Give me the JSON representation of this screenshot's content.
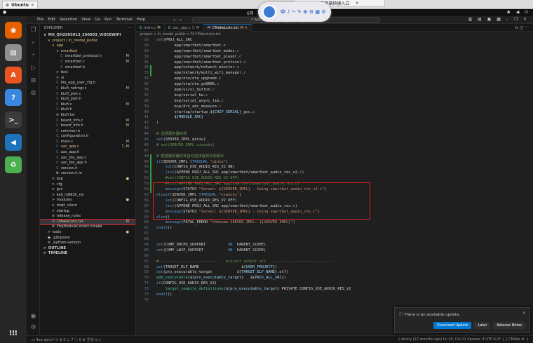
{
  "vm": {
    "tab_title": "Ubuntu",
    "remote_tab_title": "工具箱快捷入口"
  },
  "remote_pill": {
    "label": "中 ♪ ·· ✎ ⊕ ⚙ ▦ ⚙"
  },
  "ubuntu_bar": {
    "activities": "●",
    "clock": "6月",
    "tray": "♣ ◀ ⏻"
  },
  "vscode": {
    "menu": [
      "File",
      "Edit",
      "Selection",
      "View",
      "Go",
      "Run",
      "Terminal",
      "Help"
    ],
    "nav": "← →",
    "search": "MX_QH2505013_260603_viocewifi",
    "actions": "▥ ▤ ▣ ▦ – ❐ ×"
  },
  "sidebar": {
    "header": "EXPLORER",
    "header_menu": "···",
    "rows": [
      {
        "ic": "∨",
        "label": "MX_QH2505013_260603_VIOCEWIFI",
        "bold": true,
        "indent": 0
      },
      {
        "ic": "∨",
        "label": "project / ln_model_public",
        "color": "#e2c08d",
        "indent": 1
      },
      {
        "ic": "∨",
        "label": "app",
        "color": "#e2c08d",
        "indent": 2
      },
      {
        "ic": "∨",
        "label": "smartbot",
        "color": "#e2c08d",
        "indent": 3
      },
      {
        "ic": "C",
        "label": "smartbot_protocol.h",
        "indent": 4,
        "badge": "M",
        "bc": "#e2c08d"
      },
      {
        "ic": "C",
        "label": "smartbot.c",
        "indent": 4,
        "badge": "M",
        "bc": "#e2c08d"
      },
      {
        "ic": "C",
        "label": "smartbot.h",
        "indent": 4
      },
      {
        "ic": ">",
        "label": "test",
        "indent": 3
      },
      {
        "ic": ">",
        "label": "ui",
        "indent": 3
      },
      {
        "ic": "C",
        "label": "ble_app_user_cfg.h",
        "indent": 3
      },
      {
        "ic": "C",
        "label": "blufi_netmgr.c",
        "indent": 3,
        "badge": "M",
        "bc": "#e2c08d"
      },
      {
        "ic": "C",
        "label": "blufi_port.c",
        "indent": 3
      },
      {
        "ic": "C",
        "label": "blufi_port.h",
        "indent": 3
      },
      {
        "ic": "C",
        "label": "blufi.c",
        "indent": 3,
        "badge": "M",
        "bc": "#e2c08d"
      },
      {
        "ic": "C",
        "label": "blufi.h",
        "indent": 3
      },
      {
        "ic": "≡",
        "label": "blufi.txt",
        "indent": 3
      },
      {
        "ic": "C",
        "label": "board_info.c",
        "indent": 3,
        "badge": "M",
        "bc": "#e2c08d"
      },
      {
        "ic": "C",
        "label": "board_info.h",
        "indent": 3,
        "badge": "M",
        "bc": "#e2c08d"
      },
      {
        "ic": "C",
        "label": "common.h",
        "indent": 3
      },
      {
        "ic": "C",
        "label": "configuration.h",
        "indent": 3
      },
      {
        "ic": "C",
        "label": "main.c",
        "indent": 3,
        "badge": "M",
        "bc": "#e2c08d"
      },
      {
        "ic": "C",
        "label": "uac_app.c",
        "indent": 3,
        "badge": "7, M",
        "bc": "#e2c08d",
        "color": "#e2c08d"
      },
      {
        "ic": "C",
        "label": "uac_app.h",
        "indent": 3
      },
      {
        "ic": "C",
        "label": "uac_ble_app.c",
        "indent": 3
      },
      {
        "ic": "C",
        "label": "uac_ble_app.h",
        "indent": 3
      },
      {
        "ic": "C",
        "label": "version.h",
        "indent": 3
      },
      {
        "ic": "⚙",
        "label": "version.h.in",
        "indent": 3
      },
      {
        "ic": ">",
        "label": "bsp",
        "indent": 2,
        "badge": "●",
        "bc": "#e2c08d"
      },
      {
        "ic": ">",
        "label": "cfg",
        "indent": 2
      },
      {
        "ic": ">",
        "label": "gcc",
        "indent": 2
      },
      {
        "ic": ">",
        "label": "keil_ln882h_rel",
        "indent": 2
      },
      {
        "ic": ">",
        "label": "modules",
        "indent": 2,
        "badge": "●",
        "bc": "#e2c08d"
      },
      {
        "ic": ">",
        "label": "mqtt_client",
        "indent": 2
      },
      {
        "ic": ">",
        "label": "startup",
        "indent": 2
      },
      {
        "ic": "≡",
        "label": "release_rules",
        "indent": 2
      },
      {
        "ic": "M",
        "label": "CMakeLists.txt",
        "indent": 2,
        "badge": "M",
        "bc": "#e2c08d",
        "color": "#e2c08d",
        "sel": true
      },
      {
        "ic": "≡",
        "label": "ProjModuleCollect.cmake",
        "indent": 2
      },
      {
        "ic": ">",
        "label": "tools",
        "indent": 1,
        "badge": "●",
        "bc": "#e2c08d"
      },
      {
        "ic": "◆",
        "label": ".gitignore",
        "indent": 1
      },
      {
        "ic": "≡",
        "label": ".python-version",
        "indent": 1
      },
      {
        "ic": ">",
        "label": "OUTLINE",
        "indent": 0,
        "bold": true
      },
      {
        "ic": ">",
        "label": "TIMELINE",
        "indent": 0,
        "bold": true
      }
    ]
  },
  "editor": {
    "tabs": [
      {
        "icon": "C",
        "icon_color": "#519aba",
        "label": "main.c",
        "badge": "M",
        "active": false
      },
      {
        "icon": "C",
        "icon_color": "#519aba",
        "label": "uac_app.c 7, M",
        "badge": "",
        "active": false
      },
      {
        "icon": "M",
        "icon_color": "#a074c4",
        "label": "CMakeLists.txt",
        "badge": "M ×",
        "active": true
      }
    ],
    "tab_tools": "⇆ ◫ ···",
    "breadcrumb": "project > ln_model_public > M CMakeLists.txt",
    "lines": [
      {
        "n": "16",
        "h": "<span class='k'>set</span>(PROJ_ALL_SRC"
      },
      {
        "n": "28",
        "h": "        app/smartbot/smartbot.c"
      },
      {
        "n": "29",
        "h": "        app/smartbot/smartbot_modes.<span class='s'>c</span>"
      },
      {
        "n": "30",
        "h": "        app/smartbot/smartbot_player.<span class='s'>c</span>"
      },
      {
        "n": "31",
        "h": "        app/smartbot/smartbot_protocol.<span class='s'>c</span>"
      },
      {
        "n": "32",
        "h": "        app/network/network_monitor.<span class='s'>c</span>",
        "g": "#2ea043"
      },
      {
        "n": "33",
        "h": "        app/network/multi_wifi_manager.<span class='s'>c</span>",
        "g": "#2ea043"
      },
      {
        "n": "34",
        "h": "        app/ota/ota_upgrade.<span class='s'>c</span>"
      },
      {
        "n": "35",
        "h": "        app/ota/ota_gx8006.<span class='s'>c</span>"
      },
      {
        "n": "36",
        "h": "        app/ui/ui_button.<span class='s'>c</span>"
      },
      {
        "n": "37",
        "h": "        bsp/serial_hw.<span class='s'>c</span>"
      },
      {
        "n": "38",
        "h": "        bsp/serial_async_tim.<span class='s'>c</span>"
      },
      {
        "n": "39",
        "h": "        bsp/drv_adc_measure.<span class='s'>c</span>"
      },
      {
        "n": "40",
        "h": "        startup/startup_${<span class='v'>CHIP_SERIAL</span>}_gcc.<span class='s'>c</span>"
      },
      {
        "n": "41",
        "h": "        ${<span class='v'>MODULE_SRC</span>}"
      },
      {
        "n": "42",
        "h": "<span class='f'>)</span>"
      },
      {
        "n": "43",
        "h": ""
      },
      {
        "n": "44",
        "h": "<span class='c'># 选择服务器实现</span>"
      },
      {
        "n": "45",
        "h": "<span class='k'>set</span>(SERVER_IMPL qiniu)"
      },
      {
        "n": "46",
        "h": "<span class='c'># set(SERVER_IMPL xiaozhi)</span>"
      },
      {
        "n": "47",
        "h": ""
      },
      {
        "n": "48",
        "h": "<span class='c'># 根据服务器实现自动选择音频资源版本</span>",
        "g": "#2ea043"
      },
      {
        "n": "49",
        "h": "<span class='k'>if</span>(SERVER_IMPL <span class='k'>STREQUAL</span> <span class='s'>\"qiniu\"</span>)",
        "g": "#2ea043"
      },
      {
        "n": "50",
        "h": "    <span class='k'>set</span>(CONFIG_USE_AUDIO_RES_V2 ON)",
        "g": "#2ea043"
      },
      {
        "n": "51",
        "h": "    <span class='k'>list</span>(APPEND PROJ_ALL_SRC app/smartbot/smartbot_audio_res_v2.<span class='s'>c</span>)",
        "g": "#2ea043"
      },
      {
        "n": "52",
        "h": "    <span class='c'>#set(CONFIG_USE_AUDIO_RES_V2 OFF)</span>",
        "g": "#2ea043"
      },
      {
        "n": "53",
        "h": "    <span class='c'>#list(APPEND PROJ_ALL_SRC app/smartbot/smartbot_audio_res.c)</span>",
        "g": "#2ea043"
      },
      {
        "n": "54",
        "h": "    <span class='k'>message</span>(STATUS <span class='s'>\"Server: ${SERVER_IMPL} - Using smartbot_audio_res_v2.c\"</span>)",
        "g": "#2ea043"
      },
      {
        "n": "55",
        "h": "<span class='k'>elseif</span>(SERVER_IMPL <span class='k'>STREQUAL</span> <span class='s'>\"xiaozhi\"</span>)"
      },
      {
        "n": "56",
        "h": "    <span class='k'>set</span>(CONFIG_USE_AUDIO_RES_V2 OFF)"
      },
      {
        "n": "57",
        "h": "    <span class='k'>list</span>(APPEND PROJ_ALL_SRC app/smartbot/smartbot_audio_res.<span class='s'>c</span>)"
      },
      {
        "n": "58",
        "h": "    <span class='k'>message</span>(STATUS <span class='s'>\"Server: ${SERVER_IMPL} - Using smartbot_audio_res.c\"</span>)"
      },
      {
        "n": "59",
        "h": "<span class='k'>else</span>()"
      },
      {
        "n": "60",
        "h": "    <span class='k'>message</span>(FATAL_ERROR <span class='s'>\"Unknown SERVER_IMPL: ${SERVER_IMPL}\"</span>)"
      },
      {
        "n": "61",
        "h": "<span class='k'>endif</span>()"
      },
      {
        "n": "62",
        "h": ""
      },
      {
        "n": "63",
        "h": ""
      },
      {
        "n": "64",
        "h": "<span class='k'>set</span>(COMP_DHCPD_SUPPORT          <span class='k'>ON</span>  PARENT_SCOPE)"
      },
      {
        "n": "65",
        "h": "<span class='k'>set</span>(COMP_LWIP_SUPPORT           <span class='k'>ON</span>  PARENT_SCOPE)"
      },
      {
        "n": "66",
        "h": ""
      },
      {
        "n": "67",
        "h": "<span class='c'>#---------------------------   project output elf   ---------------------------</span>"
      },
      {
        "n": "68",
        "h": "<span class='k'>set</span>(TARGET_ELF_NAME                   ${<span class='v'>USER_PROJECT</span>})"
      },
      {
        "n": "69",
        "h": "<span class='k'>set</span>(pro_executable_target           ${<span class='v'>TARGET_ELF_NAME</span>}.elf)"
      },
      {
        "n": "70",
        "h": "<span class='y'>add_executable</span>(${<span class='v'>pro_executable_target</span>}   ${<span class='v'>PROJ_ALL_SRC</span>})"
      },
      {
        "n": "71",
        "h": "<span class='k'>if</span>(CONFIG_USE_AUDIO_RES_V2)"
      },
      {
        "n": "72",
        "h": "    <span class='y'>target_compile_definitions</span>(${<span class='v'>pro_executable_target</span>} PRIVATE CONFIG_USE_AUDIO_RES_V2"
      },
      {
        "n": "73",
        "h": "<span class='k'>endif</span>()"
      },
      {
        "n": "74",
        "h": ""
      }
    ]
  },
  "notification": {
    "message": "ⓘ There is an available update.",
    "close": "×",
    "btn_primary": "Download Update",
    "btn_later": "Later",
    "btn_notes": "Release Notes"
  },
  "statusbar": {
    "left": "⎇ 4ea-qiniu* ⟳  ⊗ 0 ⚠ 7 ⓘ 0   ⚙ 主线   ⊙   ▷",
    "right": "◊ zhuhy (12 months ago)   Ln 20, Col 21   Spaces: 4   UTF-8   LF   { } CMake   ⚙   ♫"
  },
  "dock": {
    "icons": [
      {
        "name": "firefox-icon",
        "bg": "#e66000",
        "glyph": "◉"
      },
      {
        "name": "files-icon",
        "bg": "#8f8f8f",
        "glyph": "▤"
      },
      {
        "name": "appstore-icon",
        "bg": "#e95420",
        "glyph": "A"
      },
      {
        "name": "help-icon",
        "bg": "#3a87e0",
        "glyph": "?"
      },
      {
        "name": "terminal-icon",
        "bg": "#3b3b3b",
        "glyph": ">_"
      },
      {
        "name": "vscode-icon",
        "bg": "#1e73be",
        "glyph": "◀"
      },
      {
        "name": "trash-icon",
        "bg": "#4caf50",
        "glyph": "♻"
      },
      {
        "name": "apps-grid-icon",
        "bg": "#262626",
        "glyph": "⁝⁝⁝"
      }
    ]
  }
}
